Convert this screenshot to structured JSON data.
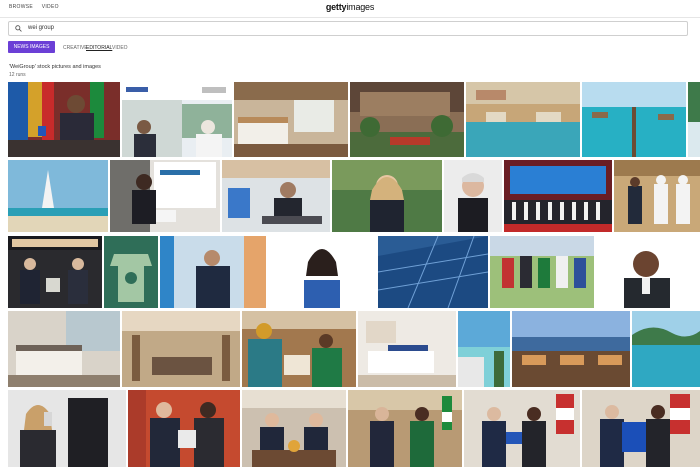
{
  "top_nav": {
    "items": [
      "BROWSE",
      "VIDEO"
    ]
  },
  "logo": {
    "bold": "getty",
    "light": "images"
  },
  "search": {
    "query": "wei group"
  },
  "filters": {
    "active_pill": "NEWS IMAGES",
    "tabs": [
      "CREATIVE",
      "EDITORIAL",
      "VIDEO"
    ],
    "active_tab": "EDITORIAL"
  },
  "results": {
    "heading": "'WeiGroup' stock pictures and images",
    "count": "12 runs"
  },
  "images": [
    "leaders-at-conference-table-with-flags",
    "officials-at-signing-ceremony",
    "hotel-bedroom-suite",
    "resort-building-courtyard",
    "resort-pool-with-umbrellas",
    "overwater-villas-jetty",
    "tropical-beach-palms",
    "burj-al-arab-beach",
    "speaker-at-podium",
    "africa-verein-event-speaker",
    "man-at-laptop-desk",
    "woman-portrait-outdoors",
    "elderly-man-portrait",
    "group-photo-on-stage",
    "officials-handshake-gulf",
    "kigali-rwanda-event",
    "football-jersey-display",
    "man-speaking-ceremony",
    "woman-portrait-blue",
    "solar-panels",
    "football-team-training",
    "man-portrait-smiling",
    "hotel-room-interior",
    "hotel-lobby-restaurant",
    "women-in-office",
    "white-bedroom-suite",
    "resort-pool-sea",
    "seaside-terrace-evening",
    "tropical-island-sea",
    "woman-with-phone",
    "men-exchanging-gift",
    "delegation-at-table",
    "dignitaries-meeting",
    "officials-handshake-flags",
    "presenting-team-shirt",
    "holding-jersey-number-ten"
  ]
}
